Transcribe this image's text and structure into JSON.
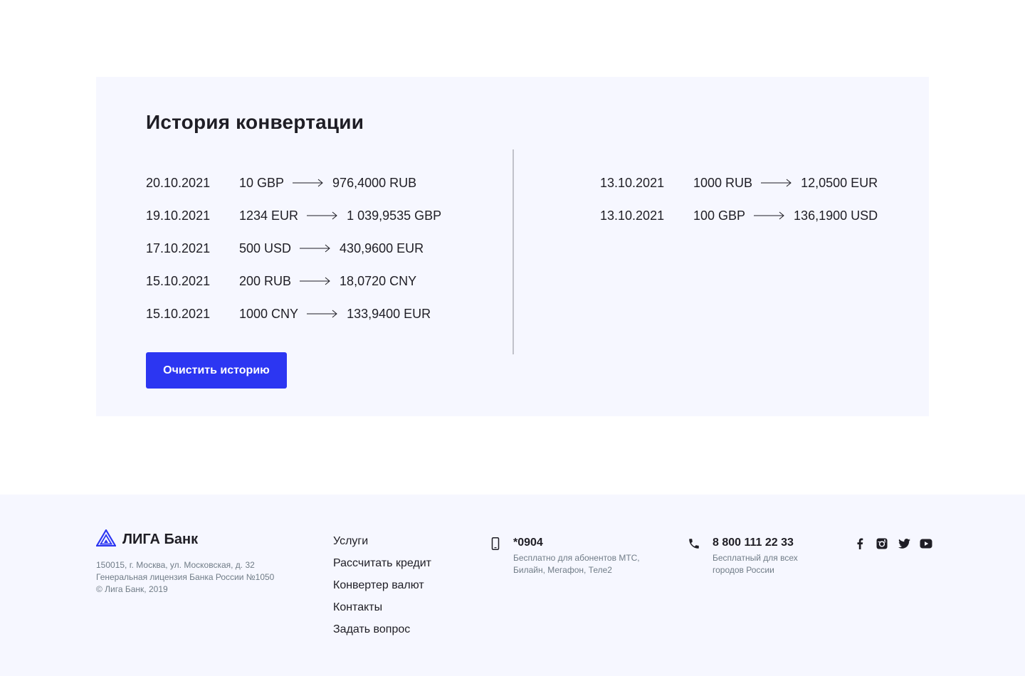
{
  "history": {
    "title": "История конвертации",
    "left_rows": [
      {
        "date": "20.10.2021",
        "from": "10 GBP",
        "to": "976,4000 RUB"
      },
      {
        "date": "19.10.2021",
        "from": "1234 EUR",
        "to": "1 039,9535 GBP"
      },
      {
        "date": "17.10.2021",
        "from": "500 USD",
        "to": "430,9600 EUR"
      },
      {
        "date": "15.10.2021",
        "from": "200 RUB",
        "to": "18,0720 CNY"
      },
      {
        "date": "15.10.2021",
        "from": "1000 CNY",
        "to": "133,9400 EUR"
      }
    ],
    "right_rows": [
      {
        "date": "13.10.2021",
        "from": "1000 RUB",
        "to": "12,0500 EUR"
      },
      {
        "date": "13.10.2021",
        "from": "100 GBP",
        "to": "136,1900 USD"
      }
    ],
    "clear_button": "Очистить историю"
  },
  "footer": {
    "logo_text": "ЛИГА Банк",
    "address_lines": [
      "150015, г. Москва, ул. Московская, д. 32",
      "Генеральная лицензия Банка России №1050",
      "© Лига Банк, 2019"
    ],
    "nav": [
      "Услуги",
      "Рассчитать кредит",
      "Конвертер валют",
      "Контакты",
      "Задать вопрос"
    ],
    "mobile": {
      "number": "*0904",
      "desc": "Бесплатно для абонентов МТС, Билайн, Мегафон, Теле2",
      "icon": "mobile-icon"
    },
    "phone": {
      "number": "8 800 111 22 33",
      "desc": "Бесплатный для всех городов России",
      "icon": "phone-icon"
    },
    "socials": [
      "facebook-icon",
      "instagram-icon",
      "twitter-icon",
      "youtube-icon"
    ]
  },
  "colors": {
    "accent": "#2c36f2",
    "panel_bg": "#f6f7ff",
    "text": "#1f1e25",
    "muted": "#707c87"
  }
}
